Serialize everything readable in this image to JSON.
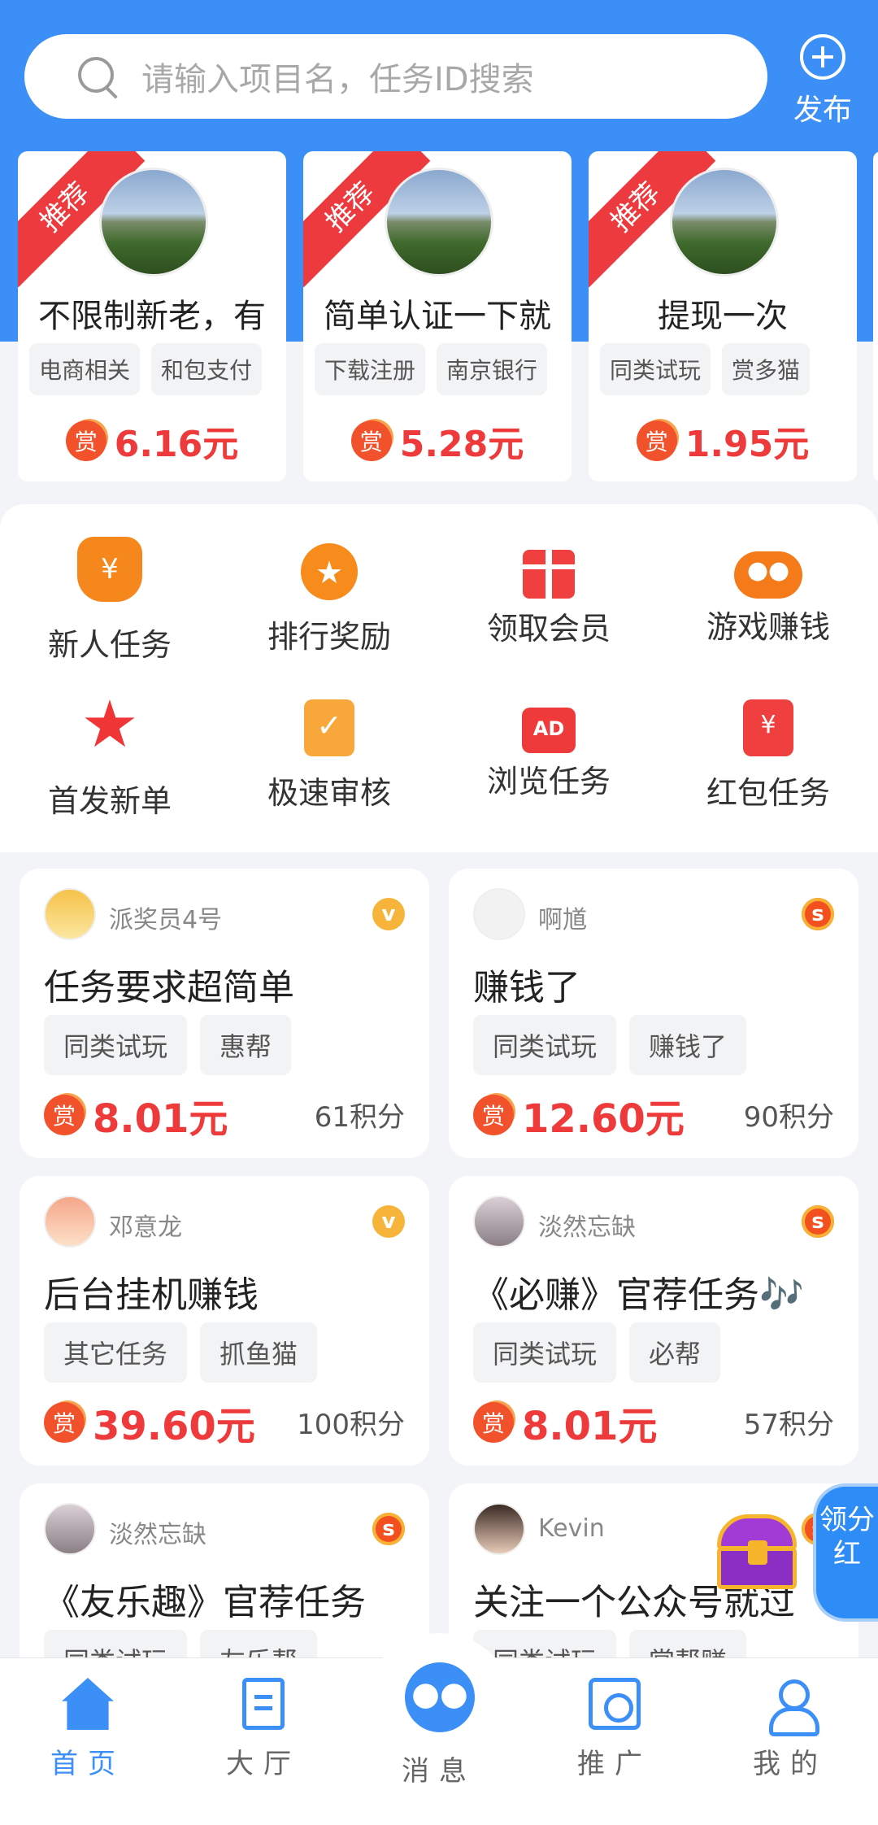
{
  "search": {
    "placeholder": "请输入项目名，任务ID搜索"
  },
  "publish": {
    "label": "发布"
  },
  "recommended": [
    {
      "ribbon": "推荐",
      "title": "不限制新老，有",
      "tags": [
        "电商相关",
        "和包支付"
      ],
      "badge": "赏",
      "amount": "6.16元"
    },
    {
      "ribbon": "推荐",
      "title": "简单认证一下就",
      "tags": [
        "下载注册",
        "南京银行"
      ],
      "badge": "赏",
      "amount": "5.28元"
    },
    {
      "ribbon": "推荐",
      "title": "提现一次",
      "tags": [
        "同类试玩",
        "赏多猫"
      ],
      "badge": "赏",
      "amount": "1.95元"
    }
  ],
  "categories": [
    {
      "label": "新人任务",
      "icon": "money-bag-icon",
      "glyph": "¥"
    },
    {
      "label": "排行奖励",
      "icon": "medal-icon",
      "glyph": "★"
    },
    {
      "label": "领取会员",
      "icon": "gift-icon",
      "glyph": ""
    },
    {
      "label": "游戏赚钱",
      "icon": "gamepad-icon",
      "glyph": "●●"
    },
    {
      "label": "首发新单",
      "icon": "star-icon",
      "glyph": "★"
    },
    {
      "label": "极速审核",
      "icon": "clipboard-check-icon",
      "glyph": "✓"
    },
    {
      "label": "浏览任务",
      "icon": "ad-icon",
      "glyph": "AD"
    },
    {
      "label": "红包任务",
      "icon": "red-envelope-icon",
      "glyph": "¥"
    }
  ],
  "tasks": [
    {
      "user": "派奖员4号",
      "level": "v",
      "title": "任务要求超简单",
      "tags": [
        "同类试玩",
        "惠帮"
      ],
      "badge": "赏",
      "amount": "8.01元",
      "points": "61积分"
    },
    {
      "user": "啊馗",
      "level": "s",
      "title": "赚钱了",
      "tags": [
        "同类试玩",
        "赚钱了"
      ],
      "badge": "赏",
      "amount": "12.60元",
      "points": "90积分"
    },
    {
      "user": "邓意龙",
      "level": "v",
      "title": "后台挂机赚钱",
      "tags": [
        "其它任务",
        "抓鱼猫"
      ],
      "badge": "赏",
      "amount": "39.60元",
      "points": "100积分"
    },
    {
      "user": "淡然忘缺",
      "level": "s",
      "title": "《必赚》官荐任务🎶",
      "tags": [
        "同类试玩",
        "必帮"
      ],
      "badge": "赏",
      "amount": "8.01元",
      "points": "57积分"
    },
    {
      "user": "淡然忘缺",
      "level": "s",
      "title": "《友乐趣》官荐任务",
      "tags": [
        "同类试玩",
        "友乐帮"
      ]
    },
    {
      "user": "Kevin",
      "level": "s",
      "title": "关注一个公众号就过",
      "tags": [
        "同类试玩",
        "赏帮赚"
      ]
    }
  ],
  "floating": {
    "fenhong": "领分红"
  },
  "nav": [
    {
      "label": "首页",
      "icon": "home-icon",
      "active": true
    },
    {
      "label": "大厅",
      "icon": "document-icon",
      "active": false
    },
    {
      "label": "消息",
      "icon": "users-icon",
      "active": false
    },
    {
      "label": "推广",
      "icon": "promote-icon",
      "active": false
    },
    {
      "label": "我的",
      "icon": "user-icon",
      "active": false
    }
  ],
  "colors": {
    "primary": "#3c8ff6",
    "price": "#ee3a3a",
    "ribbon": "#ec3a3e"
  }
}
